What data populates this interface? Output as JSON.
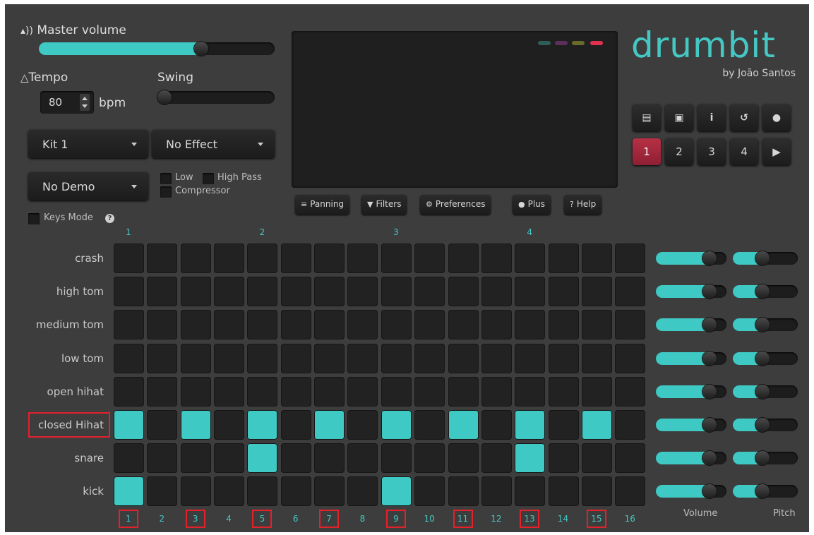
{
  "master_volume": {
    "label": "Master volume",
    "value": 0.7
  },
  "tempo": {
    "label": "Tempo",
    "value": "80",
    "unit": "bpm"
  },
  "swing": {
    "label": "Swing",
    "value": 0.0
  },
  "kit_select": {
    "selected": "Kit 1"
  },
  "effect_select": {
    "selected": "No Effect"
  },
  "demo_select": {
    "selected": "No Demo"
  },
  "filters": {
    "low": "Low",
    "high_pass": "High Pass",
    "compressor": "Compressor"
  },
  "keys_mode": {
    "label": "Keys Mode"
  },
  "toolbar": [
    {
      "name": "panning",
      "label": "Panning",
      "icon": "sliders-icon",
      "glyph": "≡"
    },
    {
      "name": "filters",
      "label": "Filters",
      "icon": "filter-icon",
      "glyph": "▼"
    },
    {
      "name": "preferences",
      "label": "Preferences",
      "icon": "gear-icon",
      "glyph": "⚙"
    },
    {
      "name": "plus",
      "label": "Plus",
      "icon": "github-icon",
      "glyph": "●"
    },
    {
      "name": "help",
      "label": "Help",
      "icon": "help-icon",
      "glyph": "?"
    }
  ],
  "brand": {
    "title": "drumbit",
    "subtitle": "by João Santos",
    "accent": "#45c8c3"
  },
  "screen_dots": [
    "#2e5c56",
    "#5a2f5c",
    "#6a6a2a",
    "#e0304f"
  ],
  "icon_buttons": [
    {
      "name": "open",
      "icon": "folder-open-icon",
      "glyph": "▤"
    },
    {
      "name": "save",
      "icon": "save-icon",
      "glyph": "▣"
    },
    {
      "name": "info",
      "icon": "info-icon",
      "glyph": "i"
    },
    {
      "name": "undo",
      "icon": "undo-icon",
      "glyph": "↺"
    },
    {
      "name": "record",
      "icon": "record-icon",
      "glyph": "●"
    }
  ],
  "patterns": [
    {
      "label": "1",
      "active": true
    },
    {
      "label": "2",
      "active": false
    },
    {
      "label": "3",
      "active": false
    },
    {
      "label": "4",
      "active": false
    },
    {
      "label": "▶",
      "active": false,
      "icon": "play-icon"
    }
  ],
  "beat_markers": [
    "1",
    "2",
    "3",
    "4"
  ],
  "step_numbers": [
    "1",
    "2",
    "3",
    "4",
    "5",
    "6",
    "7",
    "8",
    "9",
    "10",
    "11",
    "12",
    "13",
    "14",
    "15",
    "16"
  ],
  "highlighted_steps": [
    1,
    3,
    5,
    7,
    9,
    11,
    13,
    15
  ],
  "tracks": [
    {
      "name": "crash",
      "steps": [],
      "volume": 0.82,
      "pitch": 0.45
    },
    {
      "name": "high tom",
      "steps": [],
      "volume": 0.82,
      "pitch": 0.45
    },
    {
      "name": "medium tom",
      "steps": [],
      "volume": 0.82,
      "pitch": 0.45
    },
    {
      "name": "low tom",
      "steps": [],
      "volume": 0.82,
      "pitch": 0.45
    },
    {
      "name": "open hihat",
      "steps": [],
      "volume": 0.82,
      "pitch": 0.45
    },
    {
      "name": "closed Hihat",
      "steps": [
        1,
        3,
        5,
        7,
        9,
        11,
        13,
        15
      ],
      "volume": 0.82,
      "pitch": 0.45,
      "highlighted": true
    },
    {
      "name": "snare",
      "steps": [
        5,
        13
      ],
      "volume": 0.82,
      "pitch": 0.45
    },
    {
      "name": "kick",
      "steps": [
        1,
        9
      ],
      "volume": 0.82,
      "pitch": 0.45
    }
  ],
  "column_labels": {
    "volume": "Volume",
    "pitch": "Pitch"
  }
}
